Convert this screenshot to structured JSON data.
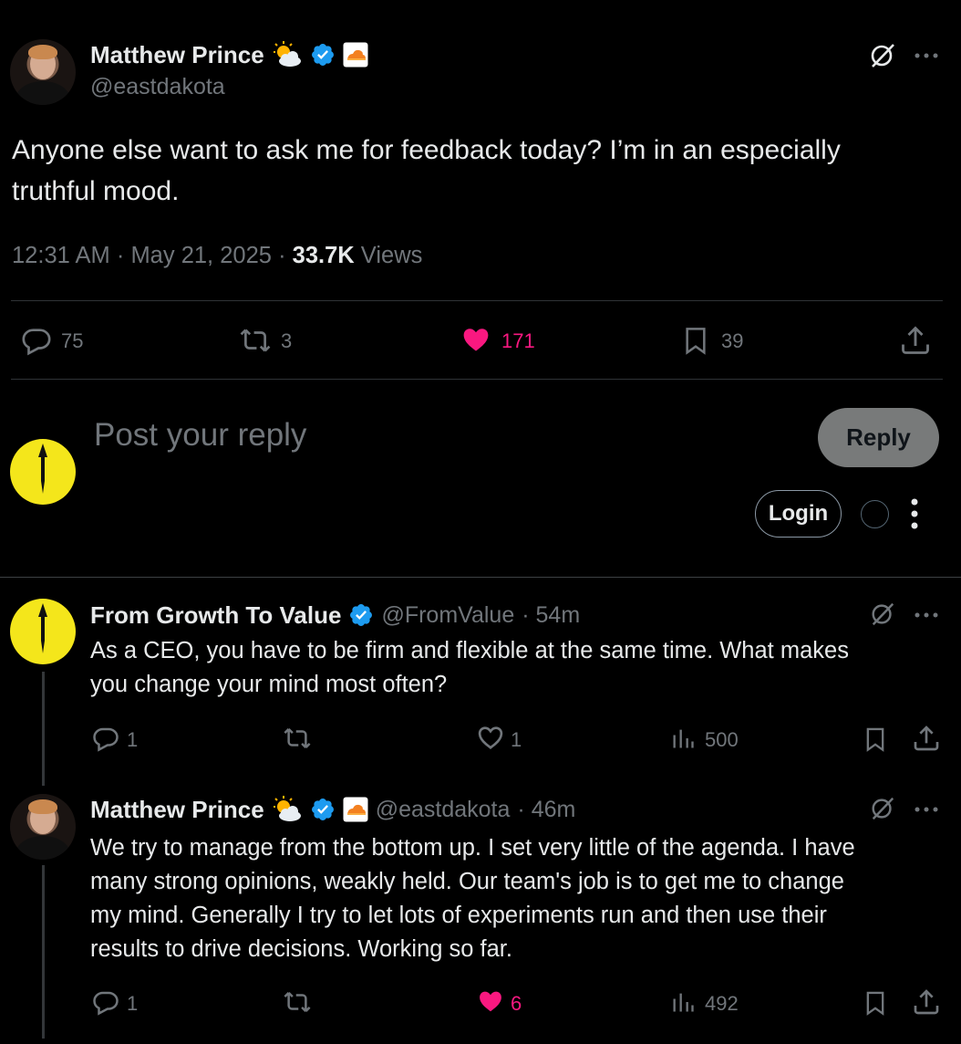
{
  "main_tweet": {
    "author_name": "Matthew Prince",
    "author_handle": "@eastdakota",
    "text_line1": "Anyone else want to ask me for feedback today? I’m in an especially",
    "text_line2": "truthful mood.",
    "time": "12:31 AM",
    "date": "May 21, 2025",
    "separator": "·",
    "views_count": "33.7K",
    "views_label": "Views",
    "replies": "75",
    "reposts": "3",
    "likes": "171",
    "bookmarks": "39"
  },
  "composer": {
    "placeholder": "Post your reply",
    "reply_button": "Reply",
    "login_button": "Login"
  },
  "replies": [
    {
      "author_name": "From Growth To Value",
      "author_handle": "@FromValue",
      "age": "· 54m",
      "lines": [
        "As a CEO, you have to be firm and flexible at the same time. What makes",
        "you change your mind most often?"
      ],
      "replies": "1",
      "reposts": "",
      "likes": "1",
      "views": "500"
    },
    {
      "author_name": "Matthew Prince",
      "author_handle": "@eastdakota",
      "age": "· 46m",
      "lines": [
        "We try to manage from the bottom up. I set very little of the agenda. I have",
        "many strong opinions, weakly held. Our team's job is to get me to change",
        "my mind. Generally I try to let lots of experiments run and then use their",
        "results to drive decisions. Working so far."
      ],
      "replies": "1",
      "reposts": "",
      "likes": "6",
      "views": "492"
    }
  ],
  "fgv_logo_text": "FROM GROWTH TO VALUE",
  "colors": {
    "background": "#000000",
    "text": "#e7e9ea",
    "muted": "#71767b",
    "like_pink": "#f91880",
    "verified_blue": "#1d9bf0",
    "fgv_yellow": "#f4e61b",
    "cloudflare_orange": "#f38020"
  },
  "icons": [
    "grok-icon",
    "more-icon",
    "reply-icon",
    "repost-icon",
    "like-icon",
    "bookmark-icon",
    "share-icon",
    "views-icon",
    "verified-badge-icon",
    "sun-cloud-emoji-icon",
    "cloudflare-icon",
    "kebab-icon"
  ]
}
